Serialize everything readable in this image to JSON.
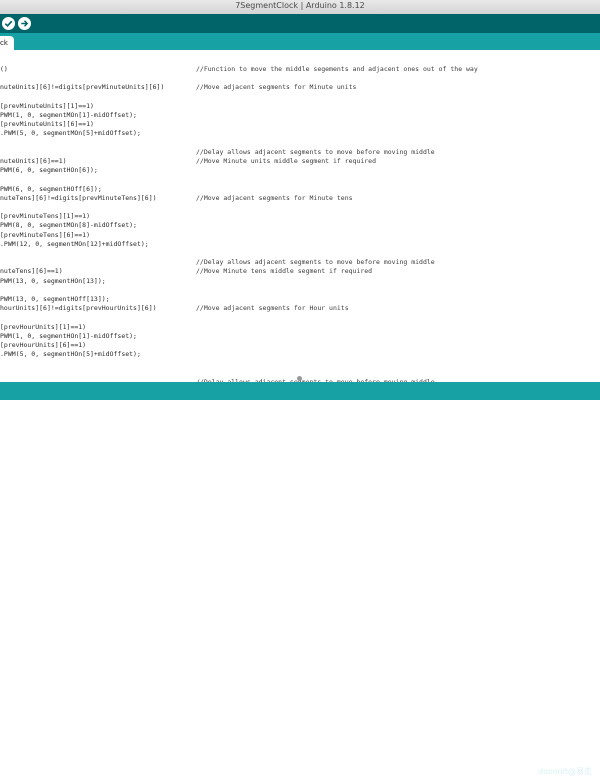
{
  "window": {
    "title": "7SegmentClock | Arduino 1.8.12"
  },
  "toolbar": {
    "buttons": [
      {
        "icon": "checkmark-icon",
        "name": "verify-button"
      },
      {
        "icon": "arrow-right-icon",
        "name": "upload-button"
      }
    ]
  },
  "tabs": [
    {
      "label": "ck"
    }
  ],
  "editor": {
    "lines": [
      {
        "code": "()",
        "comment": "//Function to move the middle segements and adjacent ones out of the way"
      },
      {
        "code": "",
        "comment": ""
      },
      {
        "code": "nuteUnits][6]!=digits[prevMinuteUnits][6])",
        "comment": "//Move adjacent segments for Minute units"
      },
      {
        "code": "",
        "comment": ""
      },
      {
        "code": "[prevMinuteUnits][1]==1)",
        "comment": ""
      },
      {
        "code": "PWM(1, 0, segmentMOn[1]-midOffset);",
        "comment": ""
      },
      {
        "code": "[prevMinuteUnits][6]==1)",
        "comment": ""
      },
      {
        "code": ".PWM(5, 0, segmentMOn[5]+midOffset);",
        "comment": ""
      },
      {
        "code": "",
        "comment": ""
      },
      {
        "code": "",
        "comment": "//Delay allows adjacent segments to move before moving middle"
      },
      {
        "code": "nuteUnits][6]==1)",
        "comment": "//Move Minute units middle segment if required"
      },
      {
        "code": "PWM(6, 0, segmentHOn[6]);",
        "comment": ""
      },
      {
        "code": "",
        "comment": ""
      },
      {
        "code": "PWM(6, 0, segmentHOff[6]);",
        "comment": ""
      },
      {
        "code": "nuteTens][6]!=digits[prevMinuteTens][6])",
        "comment": "//Move adjacent segments for Minute tens"
      },
      {
        "code": "",
        "comment": ""
      },
      {
        "code": "[prevMinuteTens][1]==1)",
        "comment": ""
      },
      {
        "code": "PWM(8, 0, segmentMOn[8]-midOffset);",
        "comment": ""
      },
      {
        "code": "[prevMinuteTens][6]==1)",
        "comment": ""
      },
      {
        "code": ".PWM(12, 0, segmentMOn[12]+midOffset);",
        "comment": ""
      },
      {
        "code": "",
        "comment": ""
      },
      {
        "code": "",
        "comment": "//Delay allows adjacent segments to move before moving middle"
      },
      {
        "code": "nuteTens][6]==1)",
        "comment": "//Move Minute tens middle segment if required"
      },
      {
        "code": "PWM(13, 0, segmentHOn[13]);",
        "comment": ""
      },
      {
        "code": "",
        "comment": ""
      },
      {
        "code": "PWM(13, 0, segmentHOff[13]);",
        "comment": ""
      },
      {
        "code": "hourUnits][6]!=digits[prevHourUnits][6])",
        "comment": "//Move adjacent segments for Hour units"
      },
      {
        "code": "",
        "comment": ""
      },
      {
        "code": "[prevHourUnits][1]==1)",
        "comment": ""
      },
      {
        "code": "PWM(1, 0, segmentHOn[1]-midOffset);",
        "comment": ""
      },
      {
        "code": "[prevHourUnits][6]==1)",
        "comment": ""
      },
      {
        "code": ".PWM(5, 0, segmentHOn[5]+midOffset);",
        "comment": ""
      },
      {
        "code": "",
        "comment": ""
      },
      {
        "code": "",
        "comment": ""
      },
      {
        "code": "",
        "comment": "//Delay allows adjacent segments to move before moving middle"
      }
    ]
  },
  "watermark": {
    "text": "dooooit@易走"
  },
  "colors": {
    "toolbar": "#006468",
    "tabstrip": "#17a1a5",
    "statusbar": "#17a1a5"
  }
}
